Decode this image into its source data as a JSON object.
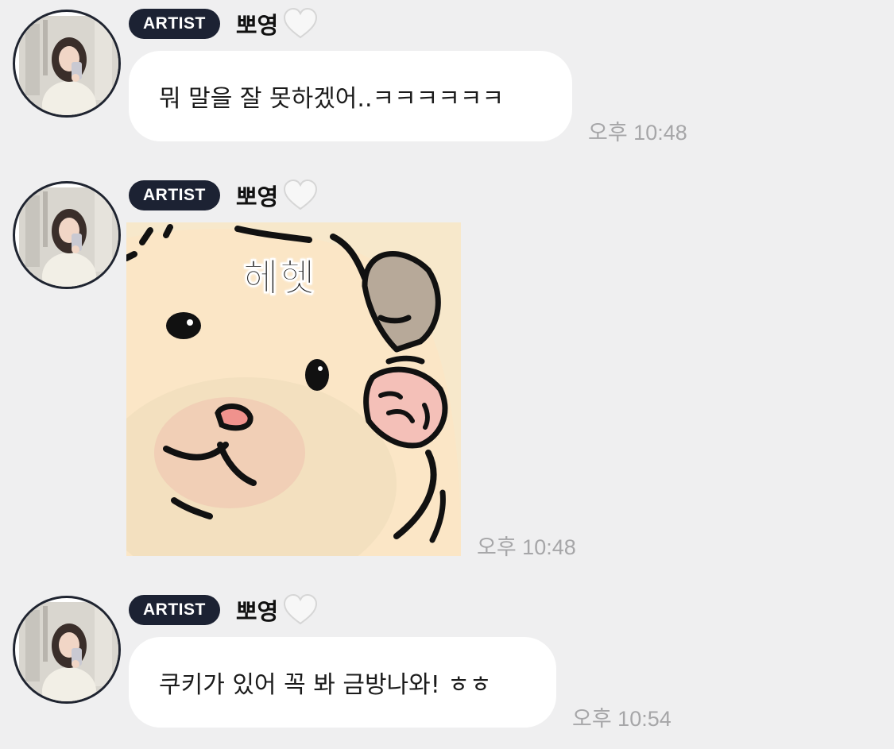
{
  "messages": [
    {
      "badge": "ARTIST",
      "sender": "뽀영",
      "text": "뭐 말을 잘 못하겠어..ㅋㅋㅋㅋㅋㅋ",
      "time": "오후 10:48"
    },
    {
      "badge": "ARTIST",
      "sender": "뽀영",
      "sticker_text": "헤헷",
      "time": "오후 10:48"
    },
    {
      "badge": "ARTIST",
      "sender": "뽀영",
      "text": "쿠키가 있어 꼭 봐 금방나와! ㅎㅎ",
      "time": "오후 10:54"
    }
  ],
  "colors": {
    "background": "#efeff0",
    "bubble": "#ffffff",
    "badge": "#1c2233",
    "time": "#a6a6a8"
  },
  "icons": {
    "heart": "white-heart-icon",
    "avatar": "profile-photo"
  }
}
